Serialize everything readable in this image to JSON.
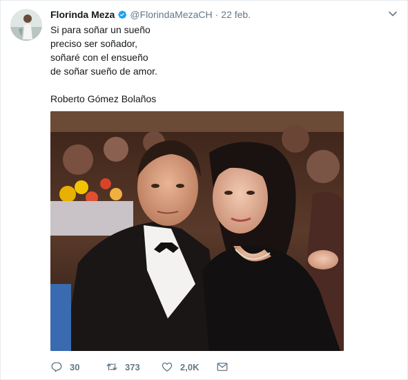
{
  "tweet": {
    "author_name": "Florinda Meza",
    "handle": "@FlorindaMezaCH",
    "separator": "·",
    "timestamp": "22 feb.",
    "verified": true,
    "text_lines": [
      "Si para soñar un sueño",
      "preciso ser soñador,",
      "soñaré con el ensueño",
      "de soñar sueño de amor."
    ],
    "signature": "Roberto Gómez Bolaños"
  },
  "actions": {
    "reply_count": "30",
    "retweet_count": "373",
    "like_count": "2,0K"
  },
  "icons": {
    "verified": "verified-badge-icon",
    "menu": "chevron-down-icon",
    "reply": "reply-icon",
    "retweet": "retweet-icon",
    "like": "heart-icon",
    "message": "envelope-icon"
  },
  "colors": {
    "text": "#14171a",
    "secondary": "#657786",
    "verified_blue": "#1da1f2",
    "border": "#e6ecf0"
  }
}
